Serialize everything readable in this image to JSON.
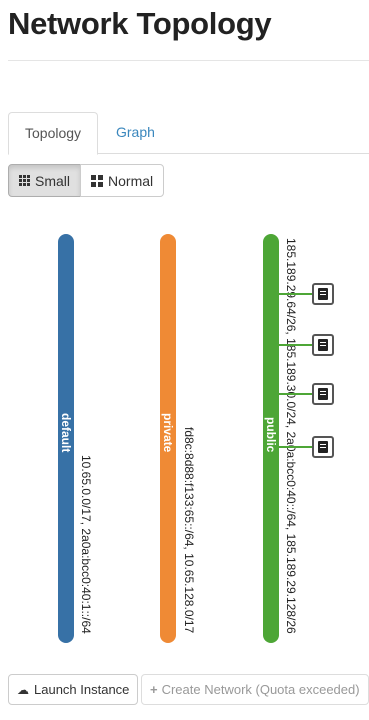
{
  "page": {
    "title": "Network Topology"
  },
  "tabs": [
    {
      "label": "Topology",
      "active": true
    },
    {
      "label": "Graph",
      "active": false
    }
  ],
  "size_toggle": {
    "small_label": "Small",
    "normal_label": "Normal",
    "selected": "Small"
  },
  "networks": [
    {
      "name": "default",
      "color": "#3771a6",
      "cidrs": "10.65.0.0/17, 2a0a:bcc0:40:1::/64"
    },
    {
      "name": "private",
      "color": "#ef8a35",
      "cidrs": "fd8c:8d88:f133:65::/64, 10.65.128.0/17"
    },
    {
      "name": "public",
      "color": "#4da636",
      "cidrs": "185.189.29.64/26, 185.189.30.0/24, 2a0a:bcc0:40::/64, 185.189.29.128/26"
    }
  ],
  "instances": [
    {
      "icon": "server-icon"
    },
    {
      "icon": "server-icon"
    },
    {
      "icon": "server-icon"
    },
    {
      "icon": "server-icon"
    }
  ],
  "actions": {
    "launch_label": "Launch Instance",
    "create_label": "Create Network (Quota exceeded)"
  }
}
